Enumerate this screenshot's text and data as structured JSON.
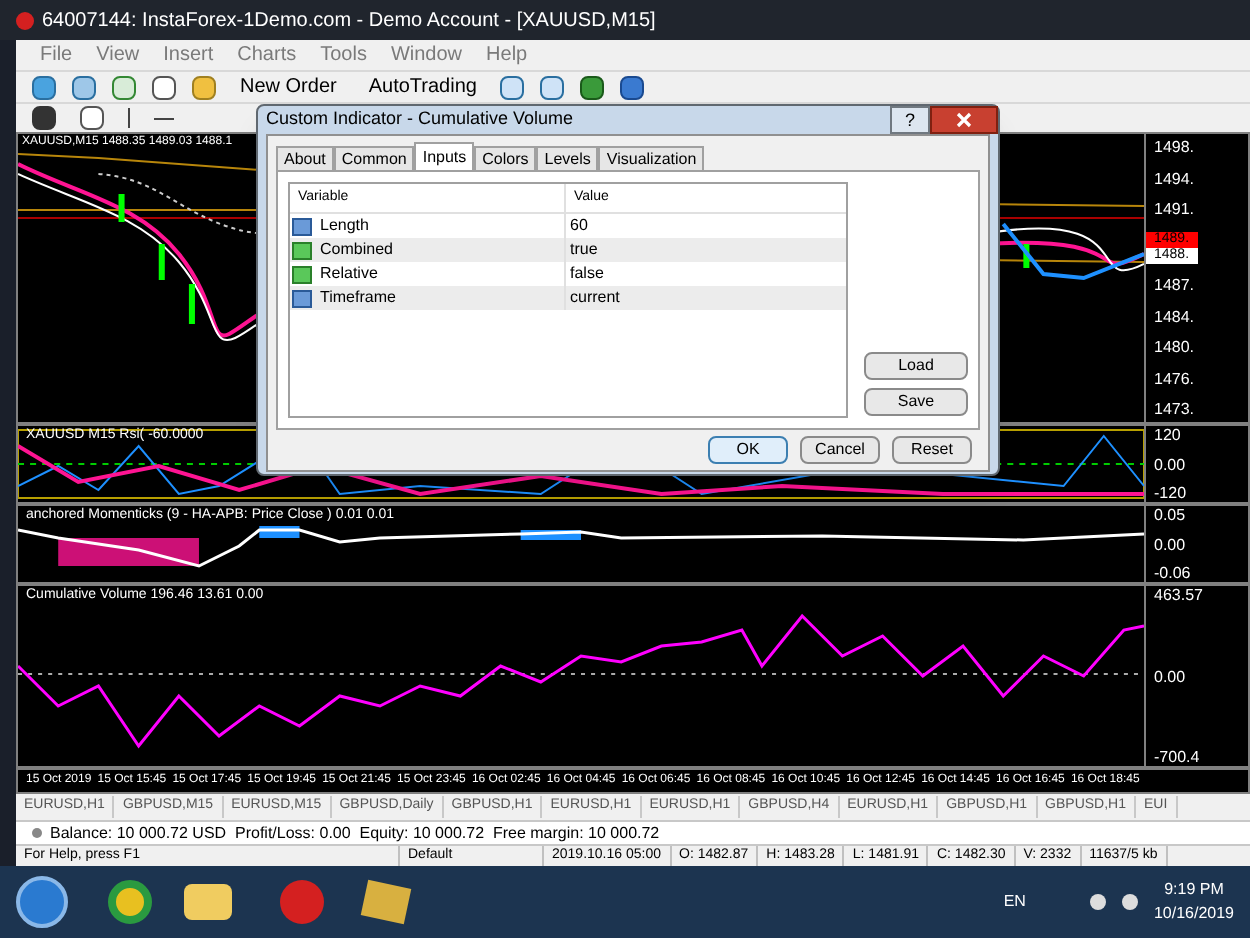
{
  "window": {
    "title": "64007144: InstaForex-1Demo.com - Demo Account - [XAUUSD,M15]"
  },
  "menu": [
    "File",
    "View",
    "Insert",
    "Charts",
    "Tools",
    "Window",
    "Help"
  ],
  "toolbar": {
    "buttons": [
      "New Order",
      "AutoTrading"
    ]
  },
  "chart": {
    "header": "XAUUSD,M15  1488.35 1489.03 1488.1",
    "price_labels": [
      "1498.",
      "1494.",
      "1491.",
      "1487.",
      "1484.",
      "1480.",
      "1476.",
      "1473."
    ],
    "price_tags": [
      {
        "text": "1489.",
        "color": "#ff0000"
      },
      {
        "text": "1488.",
        "color": "#ffffff"
      }
    ]
  },
  "subwindows": [
    {
      "label": "XAUUSD M15 Rsi( -60.0000",
      "scale": [
        "120",
        "0.00",
        "-120"
      ]
    },
    {
      "label": "anchored Momenticks (9 - HA-APB: Price Close ) 0.01 0.01",
      "scale": [
        "0.05",
        "0.00",
        "-0.06"
      ]
    },
    {
      "label": "Cumulative Volume 196.46 13.61 0.00",
      "scale": [
        "463.57",
        "0.00",
        "-700.4"
      ]
    }
  ],
  "time_axis": [
    "15 Oct 2019",
    "15 Oct 15:45",
    "15 Oct 17:45",
    "15 Oct 19:45",
    "15 Oct 21:45",
    "15 Oct 23:45",
    "16 Oct 02:45",
    "16 Oct 04:45",
    "16 Oct 06:45",
    "16 Oct 08:45",
    "16 Oct 10:45",
    "16 Oct 12:45",
    "16 Oct 14:45",
    "16 Oct 16:45",
    "16 Oct 18:45"
  ],
  "chart_tabs": [
    "EURUSD,H1",
    "GBPUSD,M15",
    "EURUSD,M15",
    "GBPUSD,Daily",
    "GBPUSD,H1",
    "EURUSD,H1",
    "EURUSD,H1",
    "GBPUSD,H4",
    "EURUSD,H1",
    "GBPUSD,H1",
    "GBPUSD,H1",
    "EUI"
  ],
  "terminal": {
    "balance_line": "Balance: 10 000.72 USD  Profit/Loss: 0.00  Equity: 10 000.72  Free margin: 10 000.72"
  },
  "status_bar": [
    "For Help, press F1",
    "Default",
    "2019.10.16 05:00",
    "O: 1482.87",
    "H: 1483.28",
    "L: 1481.91",
    "C: 1482.30",
    "V: 2332",
    "11637/5 kb"
  ],
  "dialog": {
    "title": "Custom Indicator - Cumulative Volume",
    "tabs": [
      {
        "label": "About",
        "selected": false
      },
      {
        "label": "Common",
        "selected": false
      },
      {
        "label": "Inputs",
        "selected": true
      },
      {
        "label": "Colors",
        "selected": false
      },
      {
        "label": "Levels",
        "selected": false
      },
      {
        "label": "Visualization",
        "selected": false
      }
    ],
    "columns": [
      "Variable",
      "Value"
    ],
    "rows": [
      {
        "kind": "number",
        "variable": "Length",
        "value": "60"
      },
      {
        "kind": "bool",
        "variable": "Combined",
        "value": "true"
      },
      {
        "kind": "bool",
        "variable": "Relative",
        "value": "false"
      },
      {
        "kind": "number",
        "variable": "Timeframe",
        "value": "current"
      }
    ],
    "side_buttons": [
      "Load",
      "Save"
    ],
    "buttons": [
      "OK",
      "Cancel",
      "Reset"
    ],
    "help": "?"
  },
  "taskbar": {
    "language": "EN",
    "time": "9:19 PM",
    "date": "10/16/2019"
  }
}
